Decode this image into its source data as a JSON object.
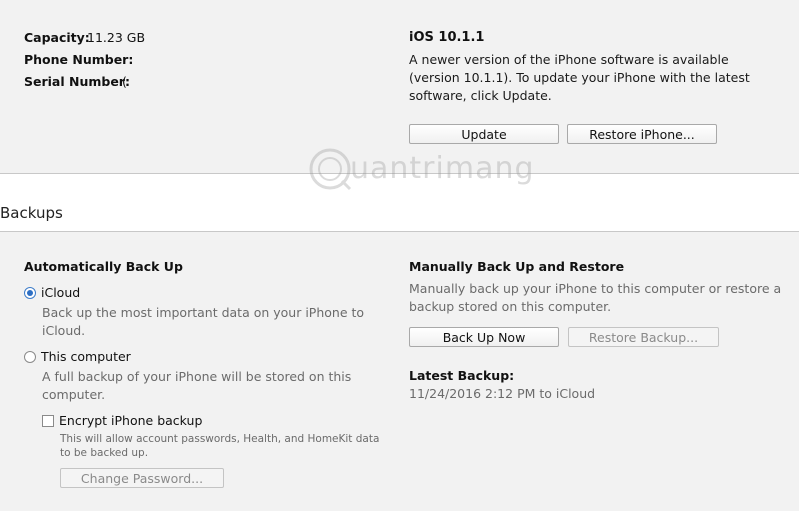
{
  "device": {
    "capacity_label": "Capacity:",
    "capacity_value": "11.23 GB",
    "phone_label": "Phone Number:",
    "phone_value": "",
    "serial_label": "Serial Number:",
    "serial_value": "("
  },
  "software": {
    "version": "iOS 10.1.1",
    "message": "A newer version of the iPhone software is available (version 10.1.1). To update your iPhone with the latest software, click Update.",
    "update_label": "Update",
    "restore_label": "Restore iPhone..."
  },
  "watermark": {
    "text": "uantrimang"
  },
  "backups": {
    "title": "Backups",
    "auto": {
      "heading": "Automatically Back Up",
      "icloud_label": "iCloud",
      "icloud_desc": "Back up the most important data on your iPhone to iCloud.",
      "computer_label": "This computer",
      "computer_desc": "A full backup of your iPhone will be stored on this computer.",
      "encrypt_label": "Encrypt iPhone backup",
      "encrypt_desc": "This will allow account passwords, Health, and HomeKit data to be backed up.",
      "change_password_label": "Change Password..."
    },
    "manual": {
      "heading": "Manually Back Up and Restore",
      "desc": "Manually back up your iPhone to this computer or restore a backup stored on this computer.",
      "back_up_now_label": "Back Up Now",
      "restore_backup_label": "Restore Backup...",
      "latest_heading": "Latest Backup:",
      "latest_value": "11/24/2016 2:12 PM to iCloud"
    }
  }
}
